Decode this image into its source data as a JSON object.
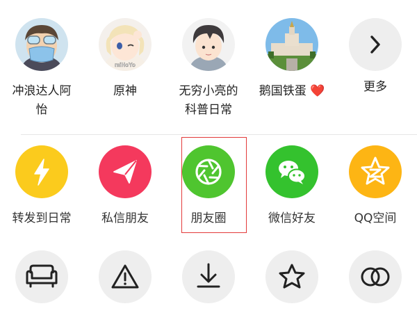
{
  "friends": [
    {
      "name_line1": "冲浪达人阿",
      "name_line2": "怡",
      "avatar": "masked-cartoon-boy-avatar"
    },
    {
      "name_line1": "原神",
      "name_line2": "",
      "avatar": "anime-girl-avatar",
      "avatar_text": "miHoYo"
    },
    {
      "name_line1": "无穷小亮的",
      "name_line2": "科普日常",
      "avatar": "cartoon-boy-avatar"
    },
    {
      "name_line1": "鹅国铁蛋",
      "name_line2": "",
      "emoji": "❤️",
      "avatar": "university-building-avatar"
    }
  ],
  "more": {
    "label": "更多",
    "icon": "chevron-right-icon"
  },
  "share_targets": [
    {
      "label": "转发到日常",
      "icon": "lightning-icon",
      "color": "#FBCB1D"
    },
    {
      "label": "私信朋友",
      "icon": "send-icon",
      "color": "#F4395D"
    },
    {
      "label": "朋友圈",
      "icon": "aperture-icon",
      "color": "#4FC52F",
      "highlighted": true
    },
    {
      "label": "微信好友",
      "icon": "wechat-icon",
      "color": "#34C22E"
    },
    {
      "label": "QQ空间",
      "icon": "qzone-star-icon",
      "color": "#FDB514"
    }
  ],
  "tools": [
    {
      "icon": "sofa-icon"
    },
    {
      "icon": "warning-icon"
    },
    {
      "icon": "download-icon"
    },
    {
      "icon": "star-icon"
    },
    {
      "icon": "duet-icon"
    }
  ],
  "colors": {
    "highlight_border": "#E33A3A",
    "tool_bg": "#EEEEEE",
    "divider": "#E6E6E6"
  }
}
